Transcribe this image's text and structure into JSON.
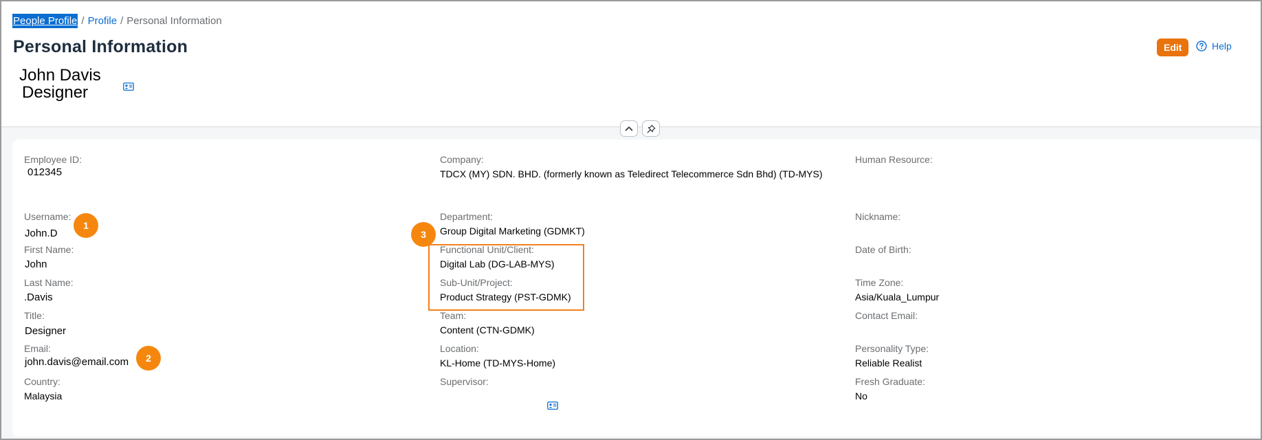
{
  "breadcrumb": {
    "items": [
      "People Profile",
      "Profile",
      "Personal Information"
    ],
    "separator": "/"
  },
  "header": {
    "title": "Personal Information",
    "name": "John Davis",
    "job_title": "Designer",
    "edit_label": "Edit",
    "help_label": "Help",
    "icons": {
      "profile_card": "contact-card-icon",
      "help": "question-circle-icon",
      "collapse": "chevron-up-icon",
      "pin": "pin-icon"
    }
  },
  "colors": {
    "accent": "#0a6ed1",
    "edit_button": "#e9730c",
    "badge": "#f5870f",
    "highlight": "#f0811e",
    "title": "#1d2d3e"
  },
  "fields": {
    "employee_id": {
      "label": "Employee ID:",
      "value": "012345"
    },
    "username": {
      "label": "Username:",
      "value": "John.D"
    },
    "first_name": {
      "label": "First Name:",
      "value": "John"
    },
    "last_name": {
      "label": "Last Name:",
      "value": ".Davis"
    },
    "title": {
      "label": "Title:",
      "value": "Designer"
    },
    "email": {
      "label": "Email:",
      "value": "john.davis@email.com"
    },
    "country": {
      "label": "Country:",
      "value": "Malaysia"
    },
    "company": {
      "label": "Company:",
      "value": "TDCX (MY) SDN. BHD. (formerly known as Teledirect Telecommerce Sdn Bhd) (TD-MYS)"
    },
    "department": {
      "label": "Department:",
      "value": "Group Digital Marketing (GDMKT)"
    },
    "functional_unit": {
      "label": "Functional Unit/Client:",
      "value": "Digital Lab (DG-LAB-MYS)"
    },
    "sub_unit": {
      "label": "Sub-Unit/Project:",
      "value": "Product Strategy (PST-GDMK)"
    },
    "team": {
      "label": "Team:",
      "value": "Content (CTN-GDMK)"
    },
    "location": {
      "label": "Location:",
      "value": "KL-Home (TD-MYS-Home)"
    },
    "supervisor": {
      "label": "Supervisor:",
      "value": ""
    },
    "human_resource": {
      "label": "Human Resource:",
      "value": ""
    },
    "nickname": {
      "label": "Nickname:",
      "value": ""
    },
    "date_of_birth": {
      "label": "Date of Birth:",
      "value": ""
    },
    "time_zone": {
      "label": "Time Zone:",
      "value": "Asia/Kuala_Lumpur"
    },
    "contact_email": {
      "label": "Contact Email:",
      "value": ""
    },
    "personality_type": {
      "label": "Personality Type:",
      "value": "Reliable Realist"
    },
    "fresh_graduate": {
      "label": "Fresh Graduate:",
      "value": "No"
    }
  },
  "annotations": {
    "badge_1": "1",
    "badge_2": "2",
    "badge_3": "3"
  }
}
